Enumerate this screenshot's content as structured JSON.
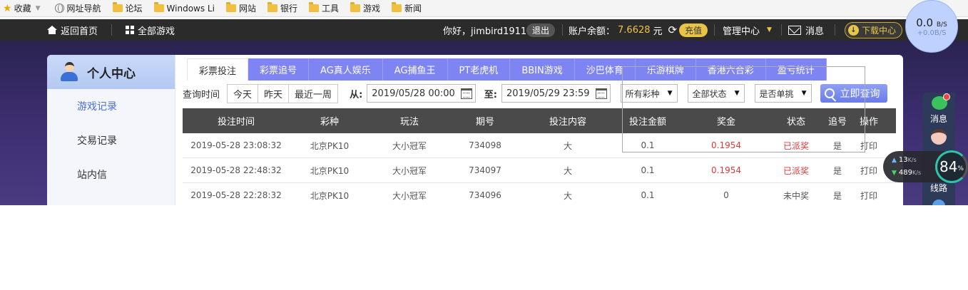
{
  "bookmarks": {
    "favorites": "收藏",
    "nav": "网址导航",
    "folders": [
      "论坛",
      "Windows Li",
      "网站",
      "银行",
      "工具",
      "游戏",
      "新闻"
    ]
  },
  "topnav": {
    "home": "返回首页",
    "all_games": "全部游戏",
    "greeting": "你好，jimbird1911",
    "logout": "退出",
    "balance_label": "账户余额：",
    "balance_value": "7.6628",
    "balance_unit": "元",
    "recharge": "充值",
    "manage": "管理中心",
    "messages": "消息",
    "download": "下载中心"
  },
  "sidebar": {
    "title": "个人中心",
    "items": [
      {
        "label": "游戏记录",
        "active": true
      },
      {
        "label": "交易记录",
        "active": false
      },
      {
        "label": "站内信",
        "active": false
      }
    ]
  },
  "tabs": [
    "彩票投注",
    "彩票追号",
    "AG真人娱乐",
    "AG捕鱼王",
    "PT老虎机",
    "BBIN游戏",
    "沙巴体育",
    "乐游棋牌",
    "香港六合彩",
    "盈亏统计"
  ],
  "filters": {
    "label": "查询时间",
    "quick": [
      "今天",
      "昨天",
      "最近一周"
    ],
    "from_label": "从:",
    "from_value": "2019/05/28 00:00",
    "to_label": "至:",
    "to_value": "2019/05/29 23:59",
    "lottery_select": "所有彩种",
    "status_select": "全部状态",
    "single_select": "是否单挑",
    "search": "立即查询"
  },
  "table": {
    "headers": [
      "投注时间",
      "彩种",
      "玩法",
      "期号",
      "投注内容",
      "投注金额",
      "奖金",
      "状态",
      "追号",
      "操作"
    ],
    "rows": [
      [
        "2019-05-28 23:08:32",
        "北京PK10",
        "大小冠军",
        "734098",
        "大",
        "0.1",
        "0.1954",
        "已派奖",
        "是",
        "打印"
      ],
      [
        "2019-05-28 22:48:32",
        "北京PK10",
        "大小冠军",
        "734097",
        "大",
        "0.1",
        "0.1954",
        "已派奖",
        "是",
        "打印"
      ],
      [
        "2019-05-28 22:28:32",
        "北京PK10",
        "大小冠军",
        "734096",
        "大",
        "0.1",
        "0",
        "未中奖",
        "是",
        "打印"
      ]
    ]
  },
  "speed_widget": {
    "main_value": "0.0",
    "main_unit": "B/S",
    "sub": "+0.0B/S"
  },
  "right_dock": {
    "messages": "消息",
    "partial": "线路"
  },
  "net_monitor": {
    "up": "13",
    "up_unit": "K/s",
    "down": "489",
    "down_unit": "K/s",
    "percent": "84",
    "percent_unit": "%"
  },
  "colors": {
    "accent_tab": "#7e85f2",
    "table_header": "#4a4a4a",
    "paid": "#e03a3a",
    "balance": "#f0c24a"
  }
}
